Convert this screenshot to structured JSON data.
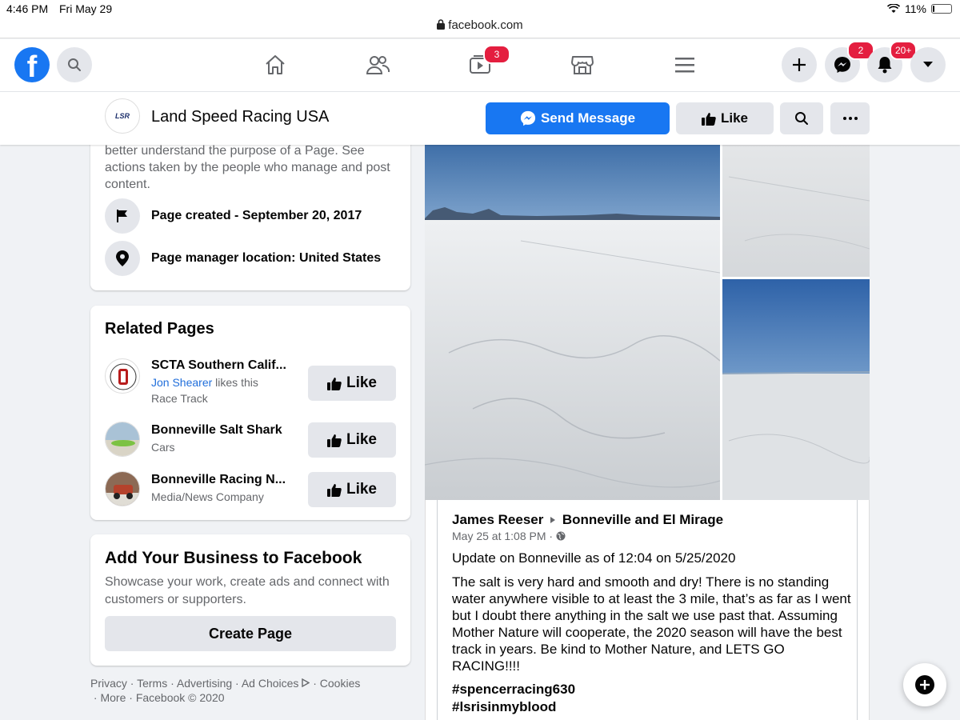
{
  "status_bar": {
    "time": "4:46 PM",
    "date": "Fri May 29",
    "battery": "11%",
    "battery_level": 0.11
  },
  "browser": {
    "url": "facebook.com"
  },
  "nav": {
    "watch_badge": "3",
    "messenger_badge": "2",
    "notifications_badge": "20+"
  },
  "page": {
    "name": "Land Speed Racing USA",
    "avatar_text": "LSR",
    "send_message_label": "Send Message",
    "like_label": "Like"
  },
  "transparency": {
    "intro_text": "better understand the purpose of a Page. See actions taken by the people who manage and post content.",
    "created": "Page created - September 20, 2017",
    "manager_location": "Page manager location: United States"
  },
  "related_pages": {
    "title": "Related Pages",
    "items": [
      {
        "name": "SCTA Southern Calif...",
        "friend": "Jon Shearer",
        "friend_suffix": " likes this",
        "category": "Race Track",
        "button": "Like"
      },
      {
        "name": "Bonneville Salt Shark",
        "category": "Cars",
        "button": "Like"
      },
      {
        "name": "Bonneville Racing N...",
        "category": "Media/News Company",
        "button": "Like"
      }
    ]
  },
  "business": {
    "title": "Add Your Business to Facebook",
    "description": "Showcase your work, create ads and connect with customers or supporters.",
    "button": "Create Page"
  },
  "footer": {
    "links": [
      "Privacy",
      "Terms",
      "Advertising",
      "Ad Choices",
      "Cookies",
      "More"
    ],
    "copyright": "Facebook © 2020"
  },
  "post": {
    "author": "James Reeser",
    "group": "Bonneville and El Mirage",
    "timestamp": "May 25 at 1:08 PM ·",
    "headline": "Update on Bonneville as of 12:04 on 5/25/2020",
    "body": "The salt is very hard and smooth and dry! There is no standing water anywhere visible to at least the 3 mile, that’s as far as I went but I doubt there anything in the salt we use past that. Assuming Mother Nature will cooperate, the 2020 season will have the best track in years. Be kind to Mother Nature, and LETS GO RACING!!!!",
    "hashtags": [
      "#spencerracing630",
      "#lsrisinmyblood"
    ]
  },
  "colors": {
    "brand": "#1877f2",
    "badge": "#e41e3f",
    "background": "#f0f2f5"
  }
}
